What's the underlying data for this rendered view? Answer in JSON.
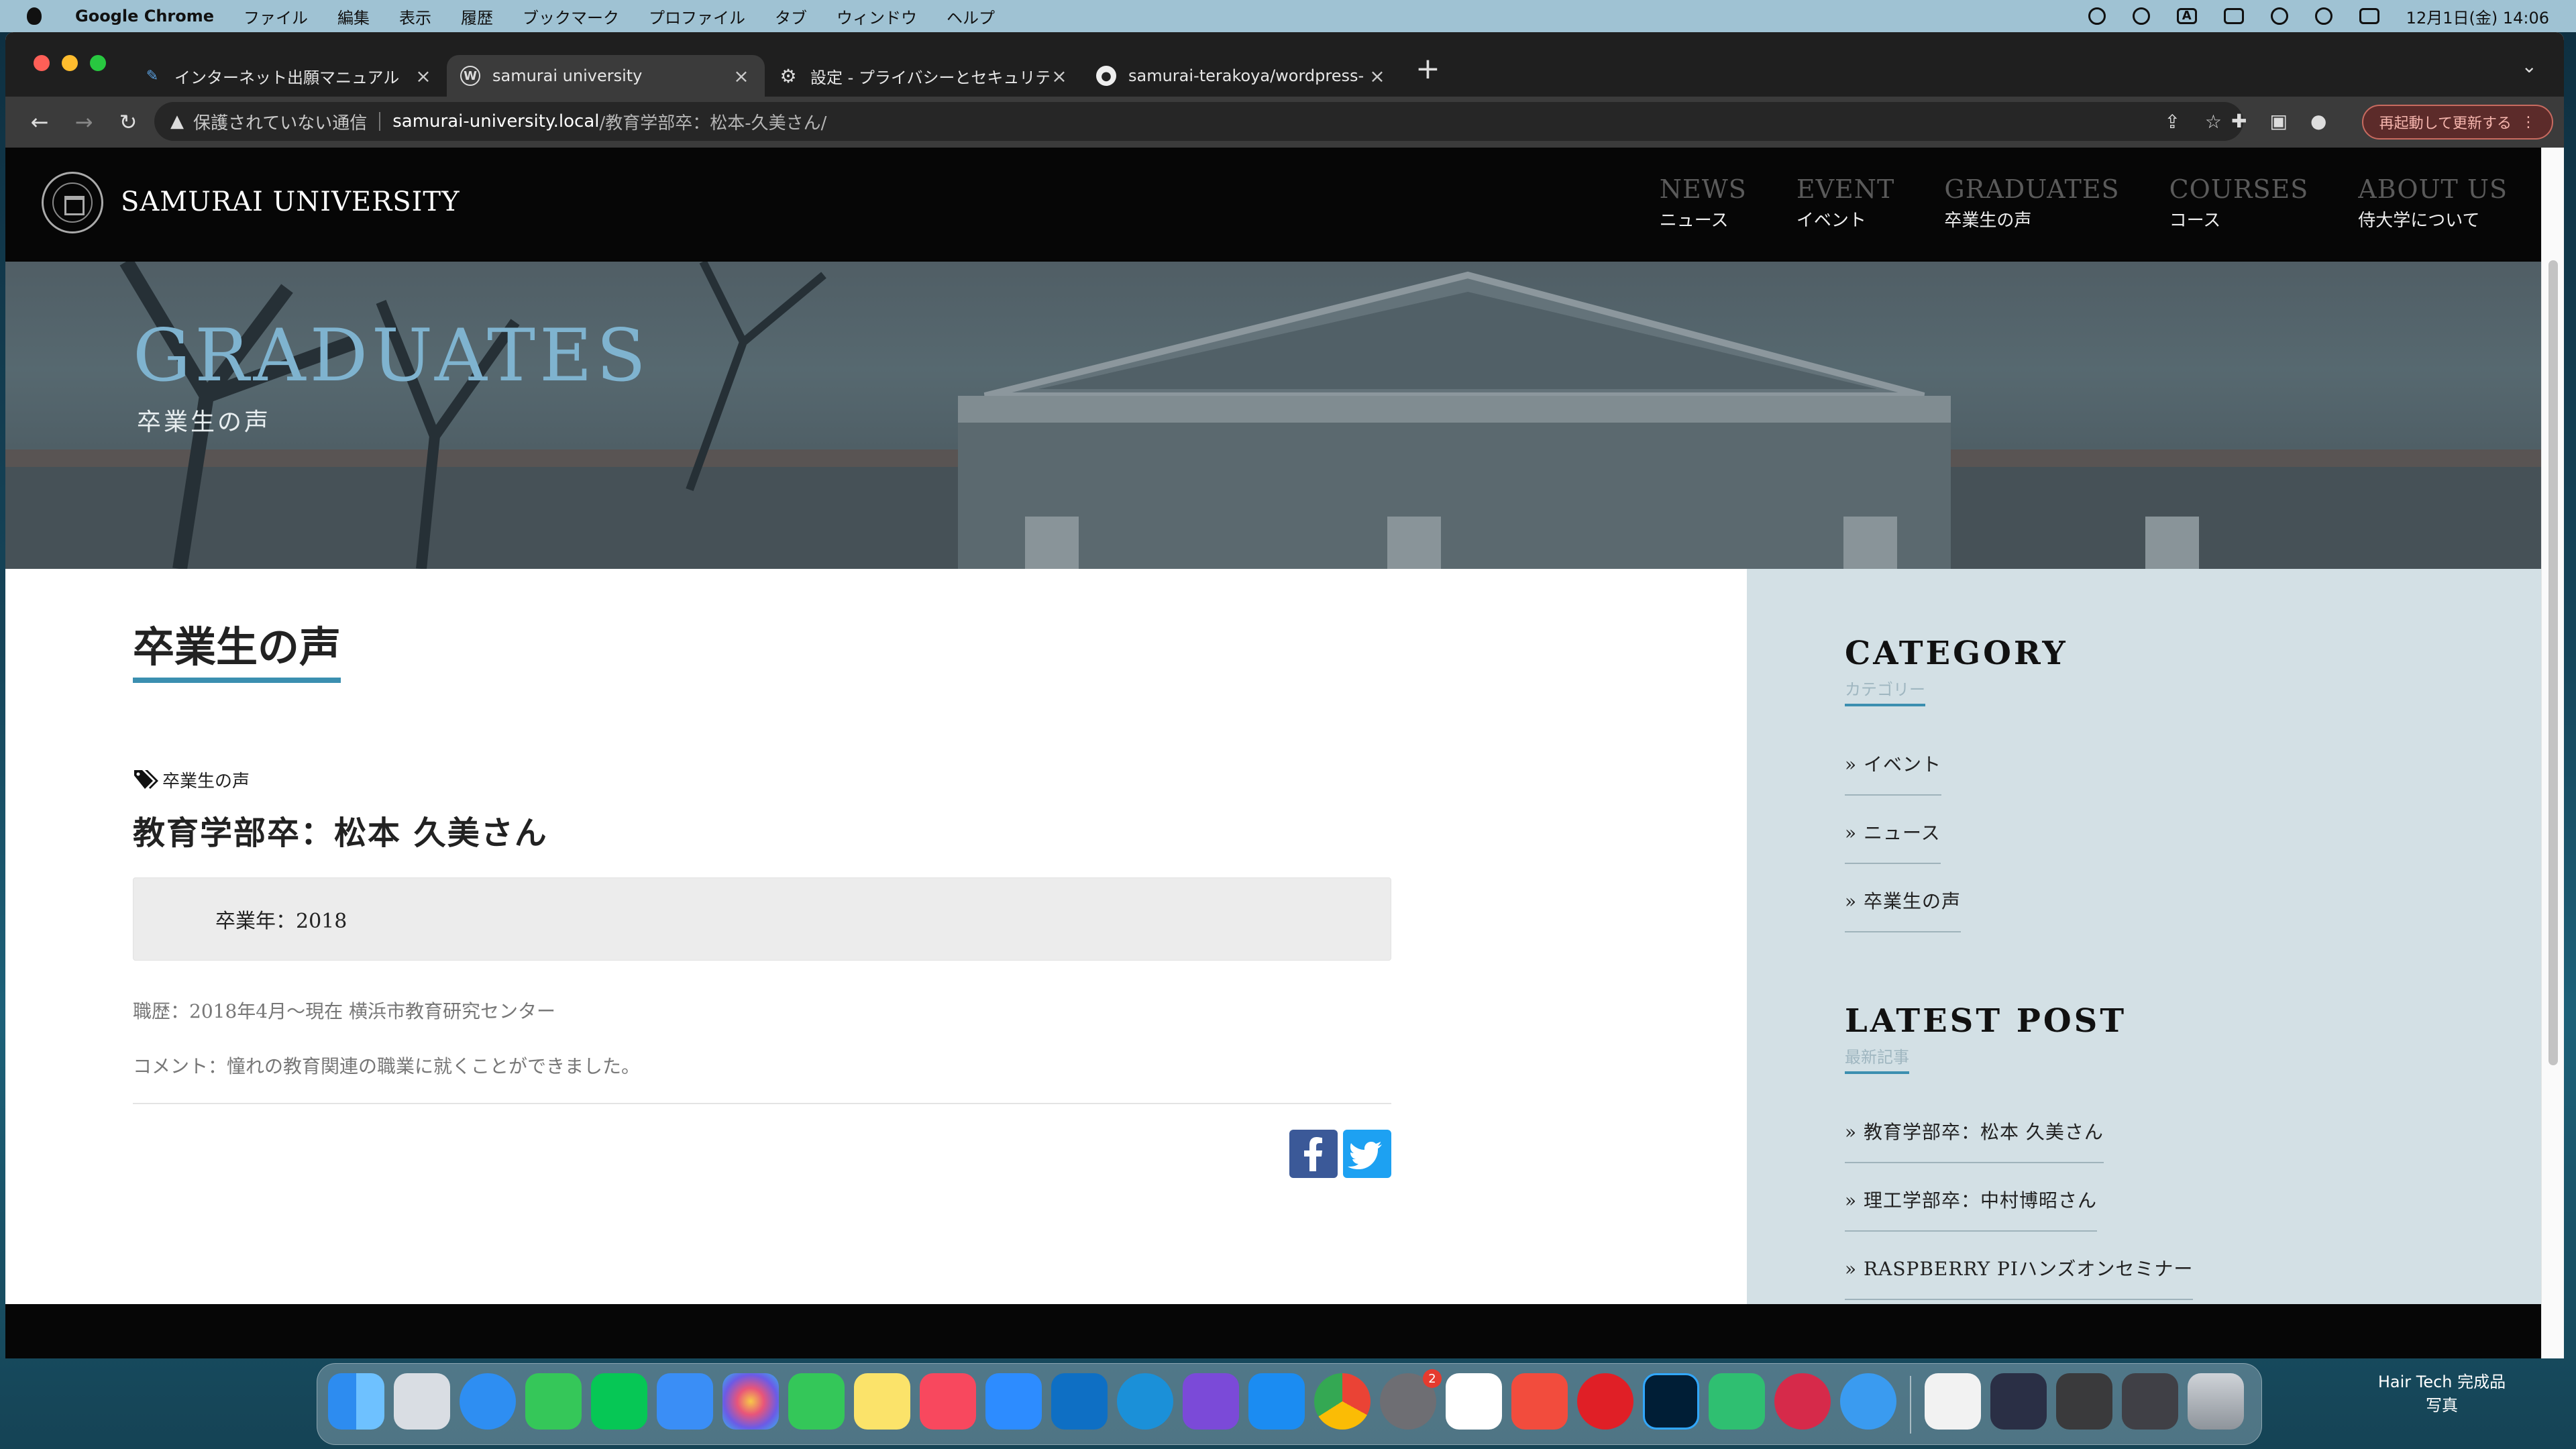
{
  "menubar": {
    "app_name": "Google Chrome",
    "menus": [
      "ファイル",
      "編集",
      "表示",
      "履歴",
      "ブックマーク",
      "プロファイル",
      "タブ",
      "ウィンドウ",
      "ヘルプ"
    ],
    "input_indicator": "A",
    "datetime": "12月1日(金)  14:06"
  },
  "browser": {
    "tabs": [
      {
        "title": "インターネット出願マニュアル",
        "favicon": "feather-icon",
        "active": false
      },
      {
        "title": "samurai university",
        "favicon": "wordpress-icon",
        "active": true
      },
      {
        "title": "設定 - プライバシーとセキュリテ",
        "favicon": "gear-icon",
        "active": false
      },
      {
        "title": "samurai-terakoya/wordpress-",
        "favicon": "github-icon",
        "active": false
      }
    ],
    "new_tab": "+",
    "address": {
      "security_text": "保護されていない通信",
      "host": "samurai-university.local",
      "path": "/教育学部卒：松本-久美さん/"
    },
    "restart_button": "再起動して更新する"
  },
  "site": {
    "name": "SAMURAI UNIVERSITY",
    "nav": [
      {
        "en": "NEWS",
        "jp": "ニュース"
      },
      {
        "en": "EVENT",
        "jp": "イベント"
      },
      {
        "en": "GRADUATES",
        "jp": "卒業生の声"
      },
      {
        "en": "COURSES",
        "jp": "コース"
      },
      {
        "en": "ABOUT US",
        "jp": "侍大学について"
      }
    ],
    "hero": {
      "title": "GRADUATES",
      "subtitle": "卒業生の声"
    }
  },
  "article": {
    "page_title": "卒業生の声",
    "category": "卒業生の声",
    "title": "教育学部卒：松本 久美さん",
    "graduation_year": "卒業年：2018",
    "career": "職歴：2018年4月〜現在 横浜市教育研究センター",
    "comment": "コメント：憧れの教育関連の職業に就くことができました。"
  },
  "sidebar": {
    "category": {
      "heading": "CATEGORY",
      "sub": "カテゴリー",
      "links": [
        "イベント",
        "ニュース",
        "卒業生の声"
      ]
    },
    "latest": {
      "heading": "LATEST POST",
      "sub": "最新記事",
      "links": [
        "教育学部卒：松本 久美さん",
        "理工学部卒：中村博昭さん",
        "RASPBERRY PIハンズオンセミナー"
      ]
    }
  },
  "dock": {
    "notification_badge": "2",
    "desktop_item": [
      "Hair Tech 完成品",
      "写真"
    ]
  },
  "colors": {
    "accent": "#3b8fb0",
    "hero_title": "#7fb3cf",
    "sidebar_bg": "#d3e0e5",
    "header_bg": "#060606"
  }
}
